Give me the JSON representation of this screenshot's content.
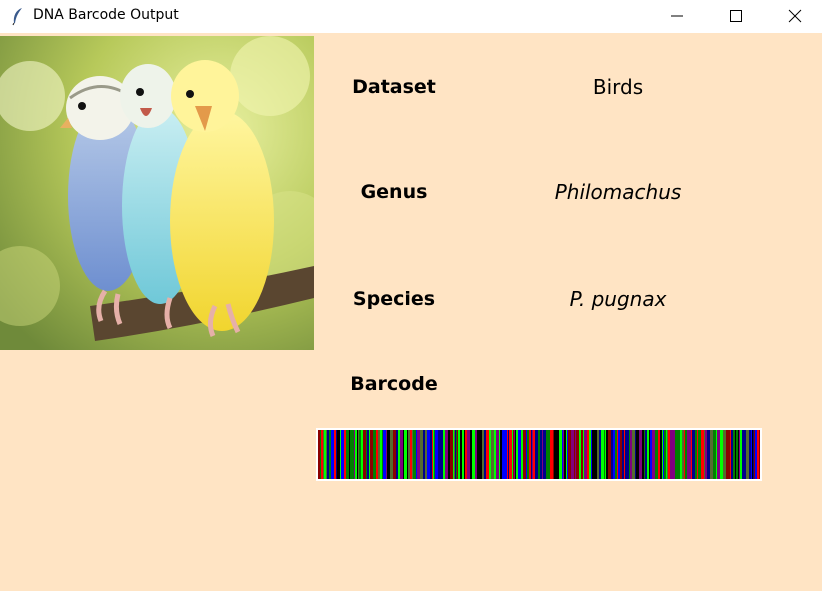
{
  "window": {
    "title": "DNA Barcode Output",
    "icon": "feather-icon"
  },
  "fields": {
    "dataset_label": "Dataset",
    "dataset_value": "Birds",
    "genus_label": "Genus",
    "genus_value": "Philomachus",
    "species_label": "Species",
    "species_value": "P. pugnax",
    "barcode_label": "Barcode"
  },
  "colors": {
    "background": "#ffe4c4",
    "barcode_palette": [
      "#00008b",
      "#0000ff",
      "#008000",
      "#00ff00",
      "#ff0000",
      "#8b0000",
      "#800080",
      "#556b2f",
      "#000000"
    ]
  },
  "image": {
    "subject": "three budgerigars on a branch"
  }
}
